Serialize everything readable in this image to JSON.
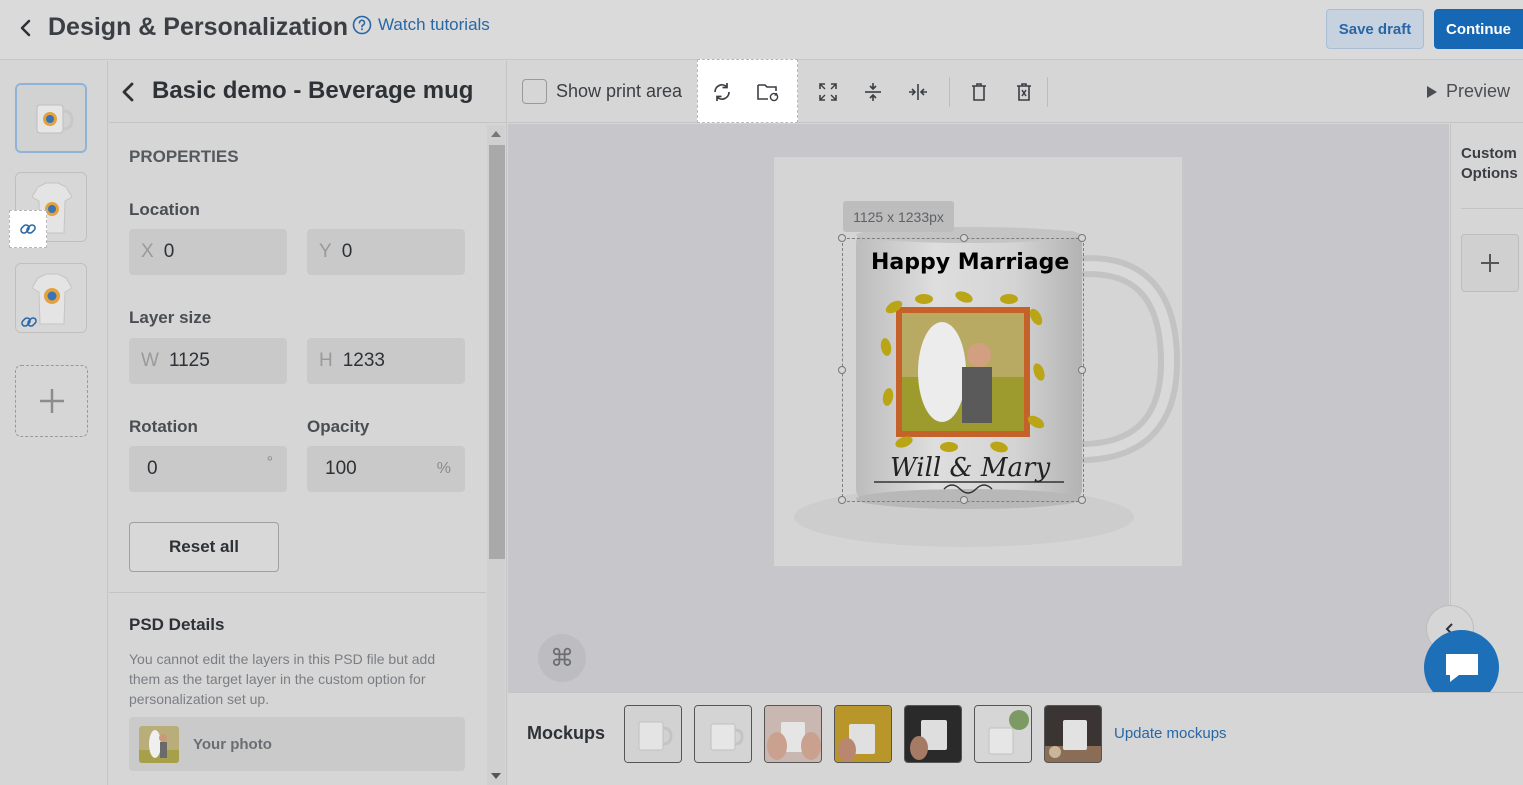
{
  "header": {
    "title": "Design & Personalization",
    "tutorials_label": "Watch tutorials",
    "save_draft_label": "Save draft",
    "continue_label": "Continue"
  },
  "panel": {
    "title": "Basic demo - Beverage mug",
    "properties_heading": "PROPERTIES",
    "location_label": "Location",
    "x_prefix": "X",
    "x_value": "0",
    "y_prefix": "Y",
    "y_value": "0",
    "layer_size_label": "Layer size",
    "w_prefix": "W",
    "w_value": "1125",
    "h_prefix": "H",
    "h_value": "1233",
    "rotation_label": "Rotation",
    "rotation_value": "0",
    "rotation_unit": "°",
    "opacity_label": "Opacity",
    "opacity_value": "100",
    "opacity_unit": "%",
    "reset_label": "Reset all",
    "psd_heading": "PSD Details",
    "psd_description": "You cannot edit the layers in this PSD file but add them as the target layer in the custom option for personalization set up.",
    "your_photo_label": "Your photo"
  },
  "toolbar": {
    "show_print_area_label": "Show print area",
    "show_print_area_checked": false,
    "tools": [
      "replace-icon",
      "replace-folder-icon",
      "fit-icon",
      "align-vertical-center-icon",
      "align-horizontal-center-icon",
      "delete-icon",
      "delete-all-icon"
    ],
    "preview_label": "Preview"
  },
  "canvas": {
    "size_tag": "1125 x 1233px",
    "mug_title": "Happy Marriage",
    "mug_signature": "Will & Mary"
  },
  "right_panel": {
    "title": "Custom Options"
  },
  "mockups": {
    "label": "Mockups",
    "update_label": "Update mockups",
    "thumbnails": [
      "white mug",
      "white mug angled",
      "mug held in hands",
      "mug on yellow background",
      "mug held by hand on dark",
      "mug with plant",
      "mug on wooden table"
    ]
  },
  "colors": {
    "accent": "#1768b4",
    "link": "#2867a6",
    "overlay": "#d6d6d6"
  }
}
